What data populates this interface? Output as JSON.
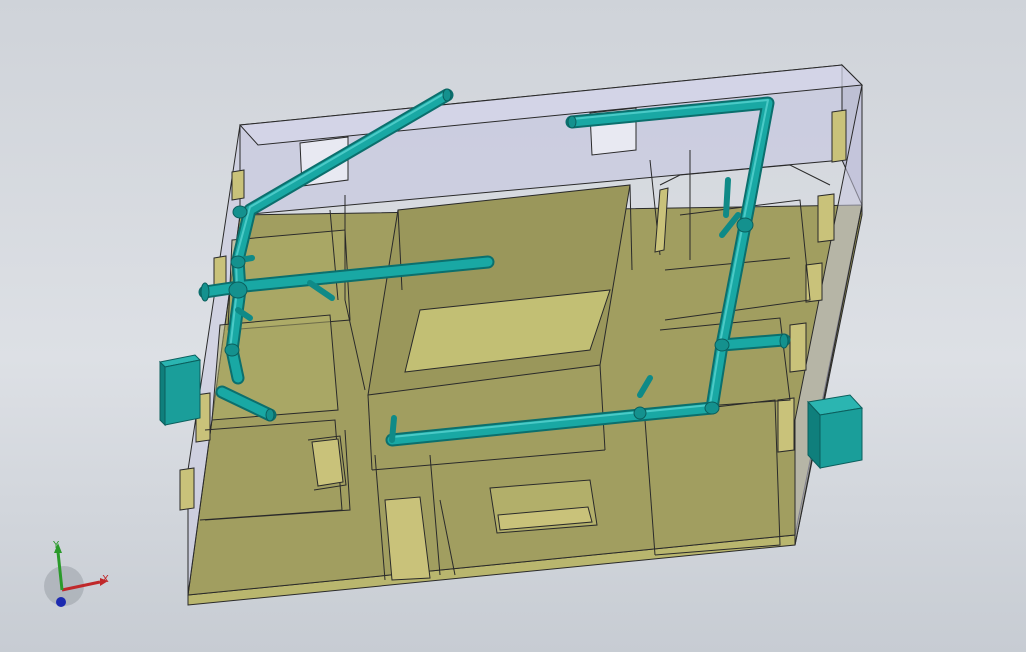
{
  "viewport": {
    "background_top": "#cfd3d9",
    "background_bottom": "#c7ccd3"
  },
  "colors": {
    "floor": "#9d9a5c",
    "floor_light": "#b9b66e",
    "wall_glass": "#c8c9e0",
    "edge": "#2a2a2a",
    "pipe": "#17a3a0",
    "pipe_dark": "#0d7a78",
    "equipment": "#1a9e9a"
  },
  "triad": {
    "x_label": "X",
    "y_label": "Y",
    "x_color": "#c0282a",
    "y_color": "#2a9a2a",
    "z_color": "#1c2ab0"
  }
}
